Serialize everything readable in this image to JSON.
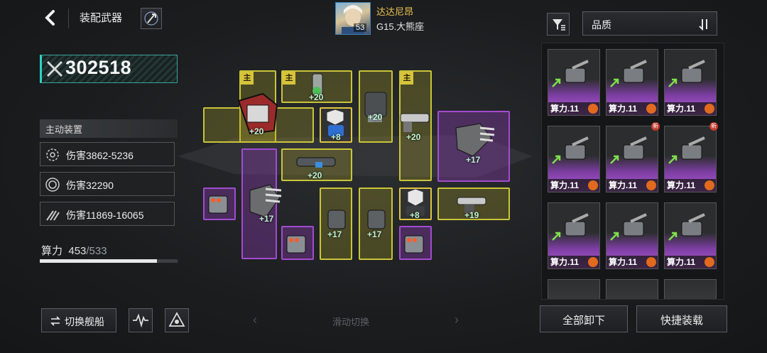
{
  "header": {
    "title": "装配武器"
  },
  "player": {
    "name": "达达尼昂",
    "server": "G15.大熊座",
    "level": "53"
  },
  "power": {
    "value": "302518"
  },
  "active_equipment": {
    "title": "主动装置",
    "damages": [
      "伤害3862-5236",
      "伤害32290",
      "伤害11869-16065"
    ]
  },
  "capacity": {
    "label": "算力",
    "used": "453",
    "total": "/533",
    "fraction": 0.85
  },
  "buttons": {
    "switch_ship": "切换舰船",
    "swipe_hint": "滑动切换",
    "unload_all": "全部卸下",
    "quick_equip": "快捷装载"
  },
  "sort": {
    "selected": "品质"
  },
  "slot_tags": {
    "main": "主"
  },
  "slot_bonuses": [
    "+20",
    "+20",
    "+20",
    "+20",
    "+8",
    "+17",
    "+20",
    "+17",
    "+17",
    "+17",
    "+8",
    "+19"
  ],
  "weapon_list": {
    "cards": [
      {
        "label": "算力.11",
        "rarity": "purple",
        "new": false
      },
      {
        "label": "算力.11",
        "rarity": "purple",
        "new": false
      },
      {
        "label": "算力.11",
        "rarity": "purple",
        "new": false
      },
      {
        "label": "算力.11",
        "rarity": "purple",
        "new": false
      },
      {
        "label": "算力.11",
        "rarity": "purple",
        "new": true
      },
      {
        "label": "算力.11",
        "rarity": "purple",
        "new": true
      },
      {
        "label": "算力.11",
        "rarity": "purple",
        "new": false
      },
      {
        "label": "算力.11",
        "rarity": "purple",
        "new": false
      },
      {
        "label": "算力.11",
        "rarity": "purple",
        "new": false
      }
    ],
    "new_badge": "新"
  },
  "colors": {
    "yellow_slot": "#c9c53a",
    "purple_slot": "#a24bd1",
    "power_accent": "#2fd3c0",
    "player_name": "#f0c650"
  }
}
